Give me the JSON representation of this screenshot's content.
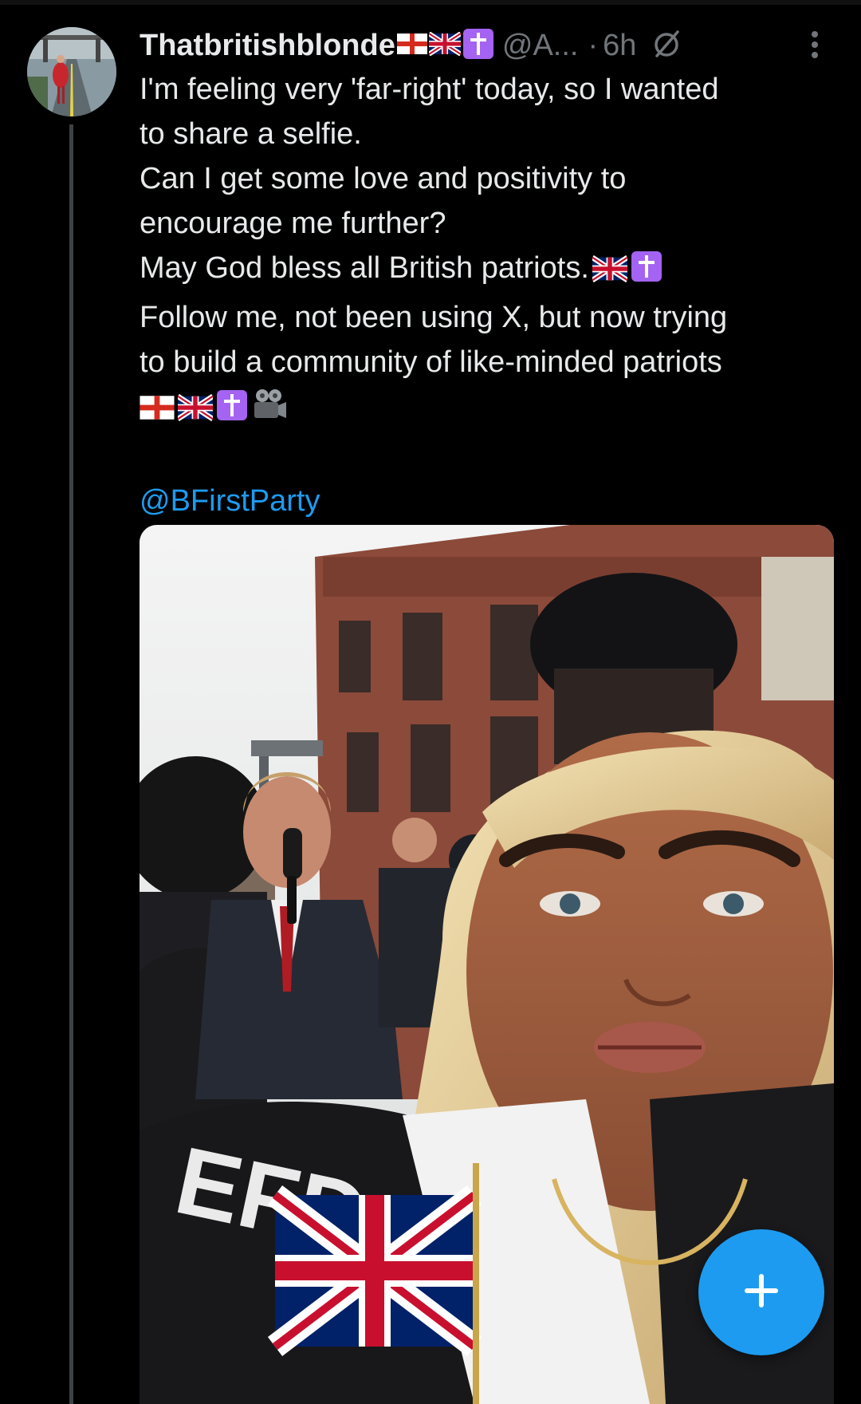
{
  "tweet": {
    "display_name": "Thatbritishblonde",
    "handle": "@A...",
    "separator": "·",
    "time": "6h",
    "lines": [
      "I'm feeling very 'far-right' today, so I wanted",
      "to share a selfie.",
      "Can I get some love and positivity to",
      "encourage me further?",
      "May God bless all British patriots.",
      "Follow me, not been using X, but now trying",
      "to build a community of like-minded patriots"
    ],
    "mention": "@BFirstParty",
    "emojis": [
      "england-flag-icon",
      "uk-flag-icon",
      "latin-cross-icon",
      "film-projector-icon"
    ]
  },
  "icons": {
    "grok": "grok-slash-icon",
    "more": "more-vertical-icon",
    "compose": "plus-icon"
  },
  "colors": {
    "background": "#000000",
    "text": "#e7e9ea",
    "secondary": "#71767b",
    "accent": "#1d9bf0",
    "cross_bg": "#a463f2"
  }
}
